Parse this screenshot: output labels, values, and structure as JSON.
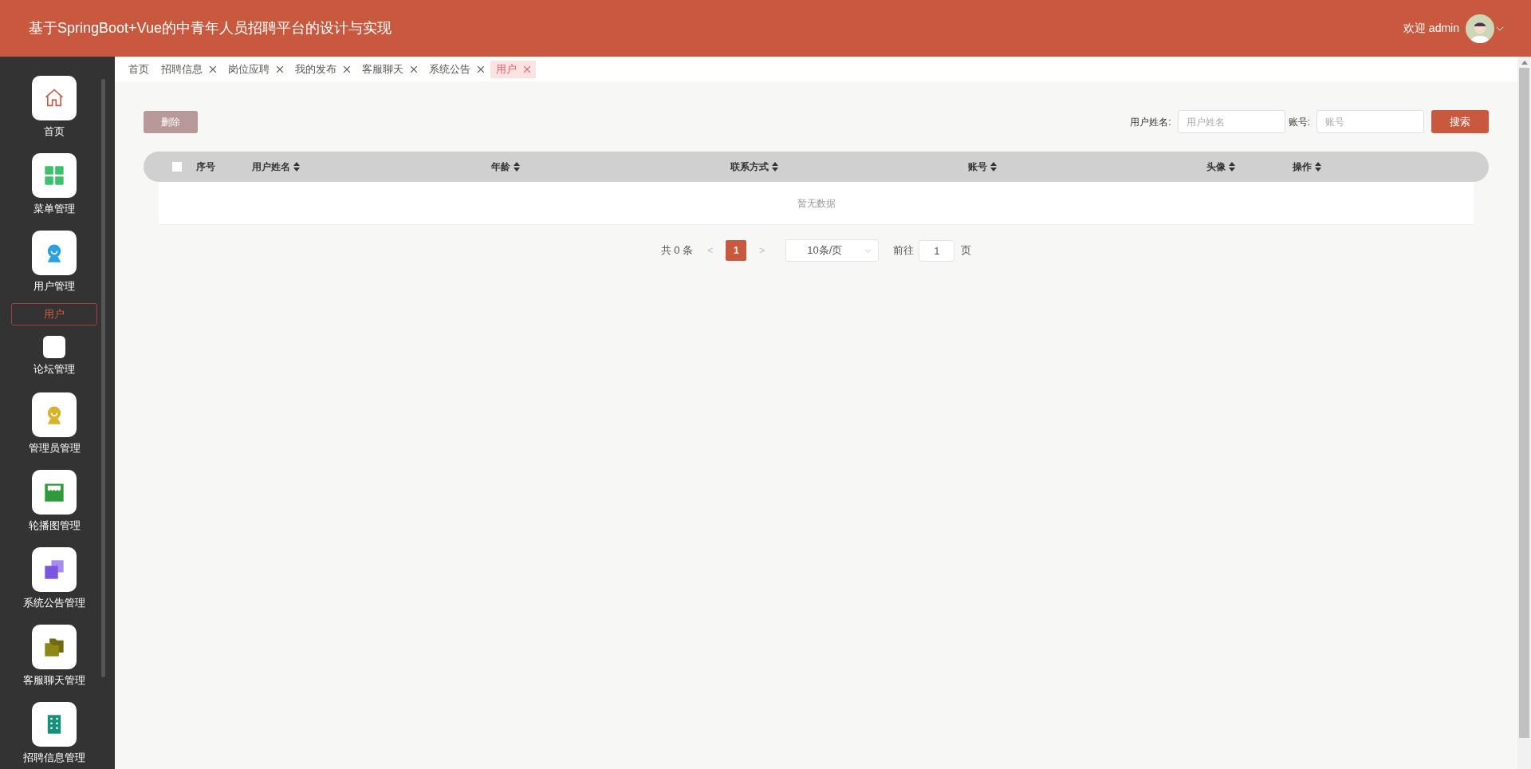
{
  "header": {
    "title": "基于SpringBoot+Vue的中青年人员招聘平台的设计与实现",
    "welcome": "欢迎 admin"
  },
  "sidebar": {
    "items": [
      {
        "label": "首页",
        "kind": "menu",
        "selected": false
      },
      {
        "label": "菜单管理",
        "kind": "menu",
        "selected": false
      },
      {
        "label": "用户管理",
        "kind": "menu",
        "selected": false
      },
      {
        "label": "用户",
        "kind": "submenu",
        "selected": true
      },
      {
        "label": "论坛管理",
        "kind": "menu",
        "selected": false
      },
      {
        "label": "管理员管理",
        "kind": "menu",
        "selected": false
      },
      {
        "label": "轮播图管理",
        "kind": "menu",
        "selected": false
      },
      {
        "label": "系统公告管理",
        "kind": "menu",
        "selected": false
      },
      {
        "label": "客服聊天管理",
        "kind": "menu",
        "selected": false
      },
      {
        "label": "招聘信息管理",
        "kind": "menu",
        "selected": false
      }
    ]
  },
  "tabs": [
    {
      "label": "首页",
      "closable": false,
      "selected": false
    },
    {
      "label": "招聘信息",
      "closable": true,
      "selected": false
    },
    {
      "label": "岗位应聘",
      "closable": true,
      "selected": false
    },
    {
      "label": "我的发布",
      "closable": true,
      "selected": false
    },
    {
      "label": "客服聊天",
      "closable": true,
      "selected": false
    },
    {
      "label": "系统公告",
      "closable": true,
      "selected": false
    },
    {
      "label": "用户",
      "closable": true,
      "selected": true
    }
  ],
  "toolbar": {
    "delete": "删除",
    "filters": [
      {
        "label": "用户姓名:",
        "placeholder": "用户姓名"
      },
      {
        "label": "账号:",
        "placeholder": "账号"
      }
    ],
    "search": "搜索"
  },
  "table": {
    "select_all": {
      "checked": false
    },
    "columns": [
      {
        "label": "序号",
        "sortable": false
      },
      {
        "label": "用户姓名",
        "sortable": true
      },
      {
        "label": "年龄",
        "sortable": true
      },
      {
        "label": "联系方式",
        "sortable": true
      },
      {
        "label": "账号",
        "sortable": true
      },
      {
        "label": "头像",
        "sortable": true
      },
      {
        "label": "操作",
        "sortable": true
      }
    ],
    "empty": "暂无数据"
  },
  "pagination": {
    "total": "共 0 条",
    "prev": "<",
    "pages": [
      {
        "label": "1",
        "selected": true
      }
    ],
    "next": ">",
    "page_size": "10条/页",
    "goto": "前往",
    "goto_value": "1",
    "page_unit": "页"
  }
}
